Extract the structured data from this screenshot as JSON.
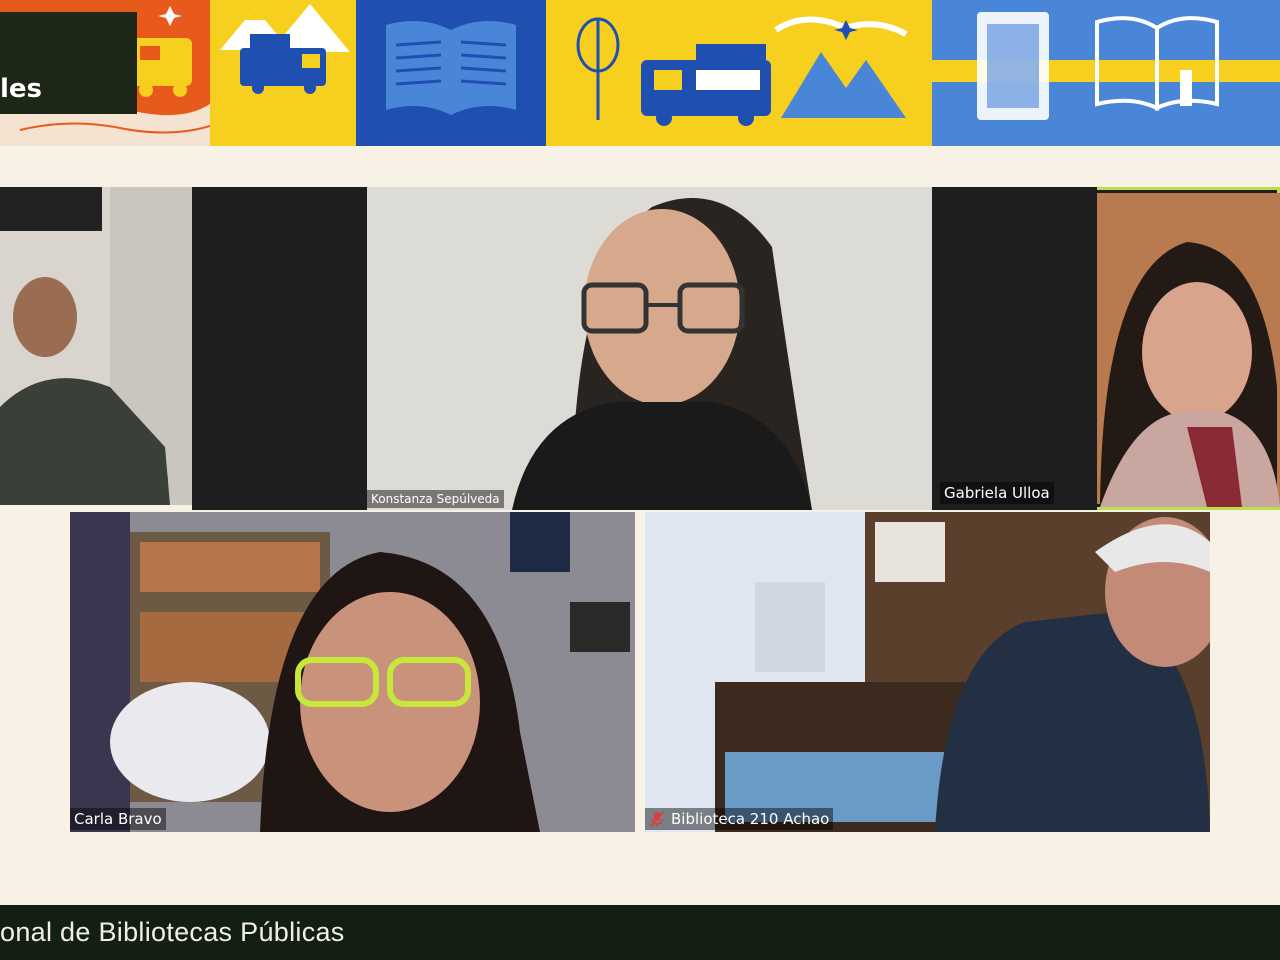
{
  "banner": {
    "title_fragment": "les",
    "colors": {
      "orange": "#e85a1c",
      "yellow": "#f6cf1f",
      "blue_dark": "#1f4fb0",
      "blue_light": "#4a86d8",
      "title_bg": "#1c2718"
    }
  },
  "participants": [
    {
      "id": "p1",
      "name": ""
    },
    {
      "id": "p2",
      "name": "Konstanza Sepúlveda"
    },
    {
      "id": "p3",
      "name": "Gabriela Ulloa",
      "active_speaker": true
    },
    {
      "id": "p4",
      "name": "Carla Bravo"
    },
    {
      "id": "p5",
      "name": "Biblioteca 210 Achao",
      "muted": true,
      "icon": "muted-mic-icon"
    }
  ],
  "footer": {
    "text": "onal de Bibliotecas Públicas"
  }
}
